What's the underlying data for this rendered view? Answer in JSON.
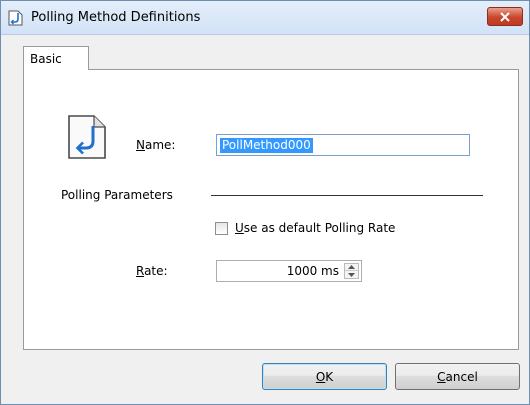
{
  "window": {
    "title": "Polling Method Definitions",
    "close_symbol": "×"
  },
  "tabs": [
    {
      "label": "Basic",
      "selected": true
    }
  ],
  "form": {
    "name_label": "Name:",
    "name_value": "PollMethod000",
    "polling_parameters_label": "Polling Parameters",
    "default_rate_checkbox_label": "Use as default Polling Rate",
    "default_rate_checked": false,
    "rate_label": "Rate:",
    "rate_value": "1000 ms"
  },
  "buttons": {
    "ok_label": "OK",
    "cancel_label": "Cancel"
  },
  "icons": {
    "title": "polling-method-icon",
    "document": "polling-document-icon",
    "close": "close-icon"
  },
  "colors": {
    "selection": "#3399ff",
    "close_button": "#c9452e",
    "icon_blue": "#1f6fd0"
  }
}
